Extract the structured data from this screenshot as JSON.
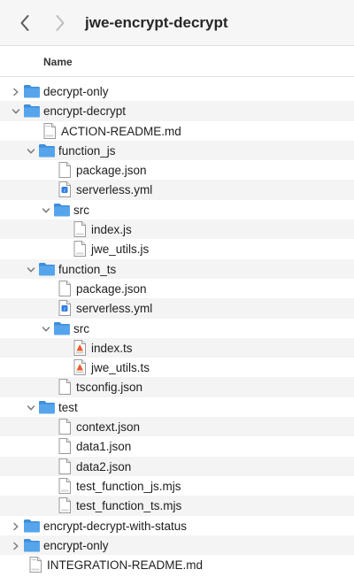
{
  "window": {
    "title": "jwe-encrypt-decrypt"
  },
  "header": {
    "column_name": "Name"
  },
  "colors": {
    "folder": "#56a5ec",
    "folder_tab": "#3d8ed9",
    "chevron": "#7a7a7a",
    "swift_orange": "#f05a28",
    "yml_blue": "#2f7de1"
  },
  "rows": [
    {
      "label": "decrypt-only",
      "depth": 0,
      "kind": "folder",
      "expander": "collapsed"
    },
    {
      "label": "encrypt-decrypt",
      "depth": 0,
      "kind": "folder",
      "expander": "expanded"
    },
    {
      "label": "ACTION-README.md",
      "depth": 1,
      "kind": "md"
    },
    {
      "label": "function_js",
      "depth": 1,
      "kind": "folder",
      "expander": "expanded"
    },
    {
      "label": "package.json",
      "depth": 2,
      "kind": "doc"
    },
    {
      "label": "serverless.yml",
      "depth": 2,
      "kind": "yml"
    },
    {
      "label": "src",
      "depth": 2,
      "kind": "folder",
      "expander": "expanded"
    },
    {
      "label": "index.js",
      "depth": 3,
      "kind": "js"
    },
    {
      "label": "jwe_utils.js",
      "depth": 3,
      "kind": "js"
    },
    {
      "label": "function_ts",
      "depth": 1,
      "kind": "folder",
      "expander": "expanded"
    },
    {
      "label": "package.json",
      "depth": 2,
      "kind": "doc"
    },
    {
      "label": "serverless.yml",
      "depth": 2,
      "kind": "yml"
    },
    {
      "label": "src",
      "depth": 2,
      "kind": "folder",
      "expander": "expanded"
    },
    {
      "label": "index.ts",
      "depth": 3,
      "kind": "ts"
    },
    {
      "label": "jwe_utils.ts",
      "depth": 3,
      "kind": "ts"
    },
    {
      "label": "tsconfig.json",
      "depth": 2,
      "kind": "doc"
    },
    {
      "label": "test",
      "depth": 1,
      "kind": "folder",
      "expander": "expanded"
    },
    {
      "label": "context.json",
      "depth": 2,
      "kind": "doc"
    },
    {
      "label": "data1.json",
      "depth": 2,
      "kind": "doc"
    },
    {
      "label": "data2.json",
      "depth": 2,
      "kind": "doc"
    },
    {
      "label": "test_function_js.mjs",
      "depth": 2,
      "kind": "js"
    },
    {
      "label": "test_function_ts.mjs",
      "depth": 2,
      "kind": "js"
    },
    {
      "label": "encrypt-decrypt-with-status",
      "depth": 0,
      "kind": "folder",
      "expander": "collapsed"
    },
    {
      "label": "encrypt-only",
      "depth": 0,
      "kind": "folder",
      "expander": "collapsed"
    },
    {
      "label": "INTEGRATION-README.md",
      "depth": 0,
      "kind": "md"
    }
  ]
}
